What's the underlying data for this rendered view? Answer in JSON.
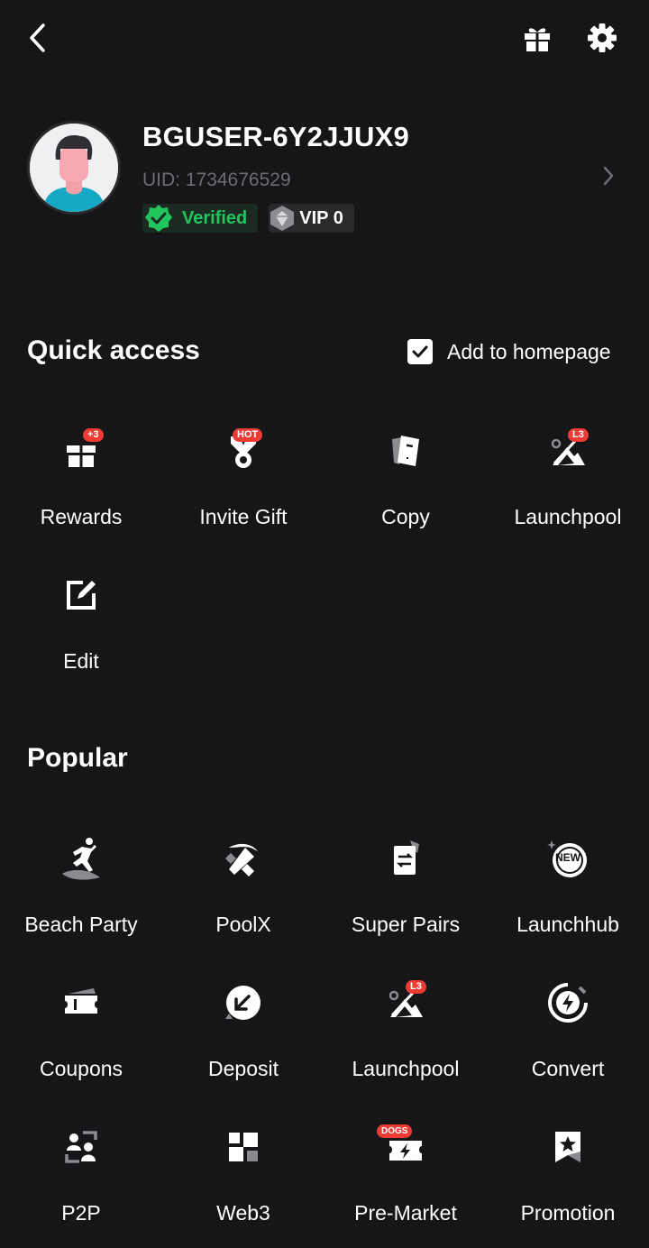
{
  "header": {
    "back_icon": "chevron-left-icon",
    "gift_icon": "gift-icon",
    "settings_icon": "gear-icon"
  },
  "profile": {
    "username": "BGUSER-6Y2JJUX9",
    "uid_label": "UID:",
    "uid_value": "1734676529",
    "verified_label": "Verified",
    "vip_label": "VIP 0",
    "accent_green": "#21c55d"
  },
  "quick_access": {
    "title": "Quick access",
    "add_to_homepage_label": "Add to homepage",
    "add_to_homepage_checked": true,
    "items": [
      {
        "label": "Rewards",
        "icon": "gift-box-icon",
        "tag": "+3"
      },
      {
        "label": "Invite Gift",
        "icon": "medal-icon",
        "tag": "HOT"
      },
      {
        "label": "Copy",
        "icon": "copy-document-icon",
        "tag": ""
      },
      {
        "label": "Launchpool",
        "icon": "mountain-pool-icon",
        "tag": "L3"
      },
      {
        "label": "Edit",
        "icon": "edit-icon",
        "tag": ""
      }
    ]
  },
  "popular": {
    "title": "Popular",
    "items": [
      {
        "label": "Beach Party",
        "icon": "surfer-icon",
        "tag": ""
      },
      {
        "label": "PoolX",
        "icon": "pickaxe-icon",
        "tag": ""
      },
      {
        "label": "Super Pairs",
        "icon": "swap-document-icon",
        "tag": ""
      },
      {
        "label": "Launchhub",
        "icon": "new-badge-icon",
        "tag": "NEW"
      },
      {
        "label": "Coupons",
        "icon": "ticket-icon",
        "tag": ""
      },
      {
        "label": "Deposit",
        "icon": "deposit-arrow-icon",
        "tag": ""
      },
      {
        "label": "Launchpool",
        "icon": "mountain-pool-icon",
        "tag": "L3"
      },
      {
        "label": "Convert",
        "icon": "lightning-circle-icon",
        "tag": ""
      },
      {
        "label": "P2P",
        "icon": "people-exchange-icon",
        "tag": ""
      },
      {
        "label": "Web3",
        "icon": "blocks-icon",
        "tag": ""
      },
      {
        "label": "Pre-Market",
        "icon": "ticket-lightning-icon",
        "tag": "DOGS"
      },
      {
        "label": "Promotion",
        "icon": "bookmark-star-icon",
        "tag": ""
      }
    ]
  }
}
